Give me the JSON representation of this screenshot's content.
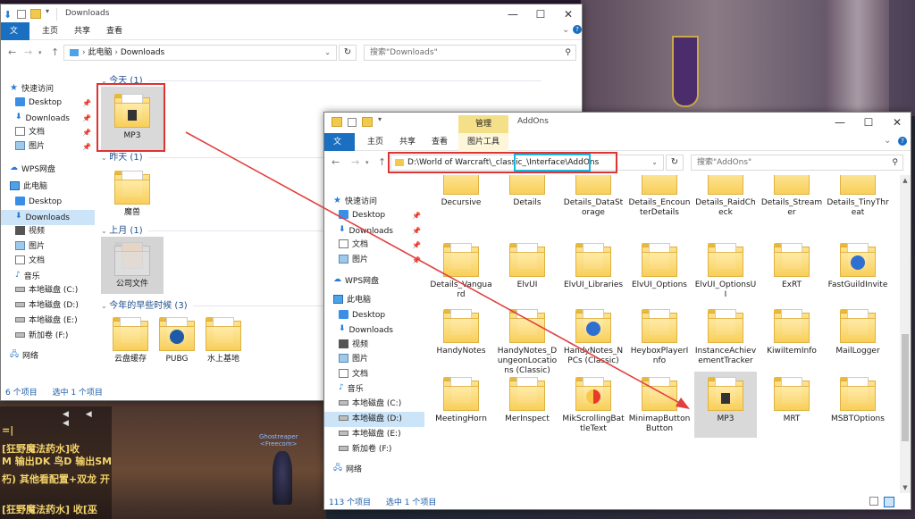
{
  "game": {
    "chat_icons": "◀ ◀ ◀",
    "chat_lines": [
      "=|",
      "[狂野魔法药水]收",
      "M 输出DK 鸟D 输出SM",
      "朽) 其他看配置+双龙 开",
      "[狂野魔法药水]  收[巫"
    ],
    "char_name": "Ghostreaper",
    "char_guild": "<Freecom>"
  },
  "win1": {
    "title": "Downloads",
    "tabs": [
      "文件",
      "主页",
      "共享",
      "查看"
    ],
    "breadcrumb": [
      "此电脑",
      "Downloads"
    ],
    "search_placeholder": "搜索\"Downloads\"",
    "sidebar": [
      {
        "label": "快速访问",
        "icon": "star-icon",
        "pin": false
      },
      {
        "label": "Desktop",
        "icon": "desktop-icon",
        "pin": true
      },
      {
        "label": "Downloads",
        "icon": "download-icon",
        "pin": true
      },
      {
        "label": "文档",
        "icon": "document-icon",
        "pin": true
      },
      {
        "label": "图片",
        "icon": "picture-icon",
        "pin": true
      },
      {
        "label": "WPS网盘",
        "icon": "cloud-icon",
        "pin": false
      },
      {
        "label": "此电脑",
        "icon": "computer-icon",
        "pin": false
      },
      {
        "label": "Desktop",
        "icon": "desktop-icon",
        "pin": false
      },
      {
        "label": "Downloads",
        "icon": "download-icon",
        "pin": false
      },
      {
        "label": "视频",
        "icon": "video-icon",
        "pin": false
      },
      {
        "label": "图片",
        "icon": "picture-icon",
        "pin": false
      },
      {
        "label": "文档",
        "icon": "document-icon",
        "pin": false
      },
      {
        "label": "音乐",
        "icon": "music-icon",
        "pin": false
      },
      {
        "label": "本地磁盘 (C:)",
        "icon": "drive-icon",
        "pin": false
      },
      {
        "label": "本地磁盘 (D:)",
        "icon": "drive-icon",
        "pin": false
      },
      {
        "label": "本地磁盘 (E:)",
        "icon": "drive-icon",
        "pin": false
      },
      {
        "label": "新加卷 (F:)",
        "icon": "drive-icon",
        "pin": false
      },
      {
        "label": "网络",
        "icon": "network-icon",
        "pin": false
      }
    ],
    "groups": [
      {
        "label": "今天 (1)",
        "items": [
          "MP3"
        ]
      },
      {
        "label": "昨天 (1)",
        "items": [
          "魔兽"
        ]
      },
      {
        "label": "上月 (1)",
        "items": [
          "公司文件"
        ]
      },
      {
        "label": "今年的早些时候 (3)",
        "items": [
          "云盘缓存",
          "PUBG",
          "水上基地"
        ]
      }
    ],
    "status_count": "6 个项目",
    "status_selected": "选中 1 个项目"
  },
  "win2": {
    "title": "AddOns",
    "manage_tab": "管理",
    "tabs": [
      "文件",
      "主页",
      "共享",
      "查看",
      "图片工具"
    ],
    "address_prefix": "D:\\World of Warcraft\\_classic_",
    "address_suffix": "\\Interface\\AddOns",
    "search_placeholder": "搜索\"AddOns\"",
    "sidebar": [
      {
        "label": "快速访问",
        "icon": "star-icon",
        "pin": false
      },
      {
        "label": "Desktop",
        "icon": "desktop-icon",
        "pin": true
      },
      {
        "label": "Downloads",
        "icon": "download-icon",
        "pin": true
      },
      {
        "label": "文档",
        "icon": "document-icon",
        "pin": true
      },
      {
        "label": "图片",
        "icon": "picture-icon",
        "pin": true
      },
      {
        "label": "WPS网盘",
        "icon": "cloud-icon",
        "pin": false
      },
      {
        "label": "此电脑",
        "icon": "computer-icon",
        "pin": false
      },
      {
        "label": "Desktop",
        "icon": "desktop-icon",
        "pin": false
      },
      {
        "label": "Downloads",
        "icon": "download-icon",
        "pin": false
      },
      {
        "label": "视频",
        "icon": "video-icon",
        "pin": false
      },
      {
        "label": "图片",
        "icon": "picture-icon",
        "pin": false
      },
      {
        "label": "文档",
        "icon": "document-icon",
        "pin": false
      },
      {
        "label": "音乐",
        "icon": "music-icon",
        "pin": false
      },
      {
        "label": "本地磁盘 (C:)",
        "icon": "drive-icon",
        "pin": false
      },
      {
        "label": "本地磁盘 (D:)",
        "icon": "drive-icon",
        "pin": false
      },
      {
        "label": "本地磁盘 (E:)",
        "icon": "drive-icon",
        "pin": false
      },
      {
        "label": "新加卷 (F:)",
        "icon": "drive-icon",
        "pin": false
      },
      {
        "label": "网络",
        "icon": "network-icon",
        "pin": false
      }
    ],
    "rows": [
      [
        "Decursive",
        "Details",
        "Details_DataStorage",
        "Details_EncounterDetails",
        "Details_RaidCheck",
        "Details_Streamer",
        "Details_TinyThreat"
      ],
      [
        "Details_Vanguard",
        "ElvUI",
        "ElvUI_Libraries",
        "ElvUI_Options",
        "ElvUI_OptionsUI",
        "ExRT",
        "FastGuildInvite"
      ],
      [
        "HandyNotes",
        "HandyNotes_DungeonLocations (Classic)",
        "HandyNotes_NPCs (Classic)",
        "HeyboxPlayerInfo",
        "InstanceAchievementTracker",
        "KiwiItemInfo",
        "MailLogger"
      ],
      [
        "MeetingHorn",
        "MerInspect",
        "MikScrollingBattleText",
        "MinimapButtonButton",
        "MP3",
        "MRT",
        "MSBTOptions"
      ]
    ],
    "status_count": "113 个项目",
    "status_selected": "选中 1 个项目"
  },
  "controls": {
    "minimize": "—",
    "maximize": "☐",
    "close": "✕",
    "back": "←",
    "forward": "→",
    "up": "↑",
    "refresh": "↻",
    "search_icon": "⚲",
    "expand": "⌄",
    "dropdown": "▾"
  },
  "colors": {
    "accent": "#1a6fc0",
    "highlight": "#d33333",
    "cyan": "#19b6e0",
    "manage_tab": "#f5e08a"
  }
}
